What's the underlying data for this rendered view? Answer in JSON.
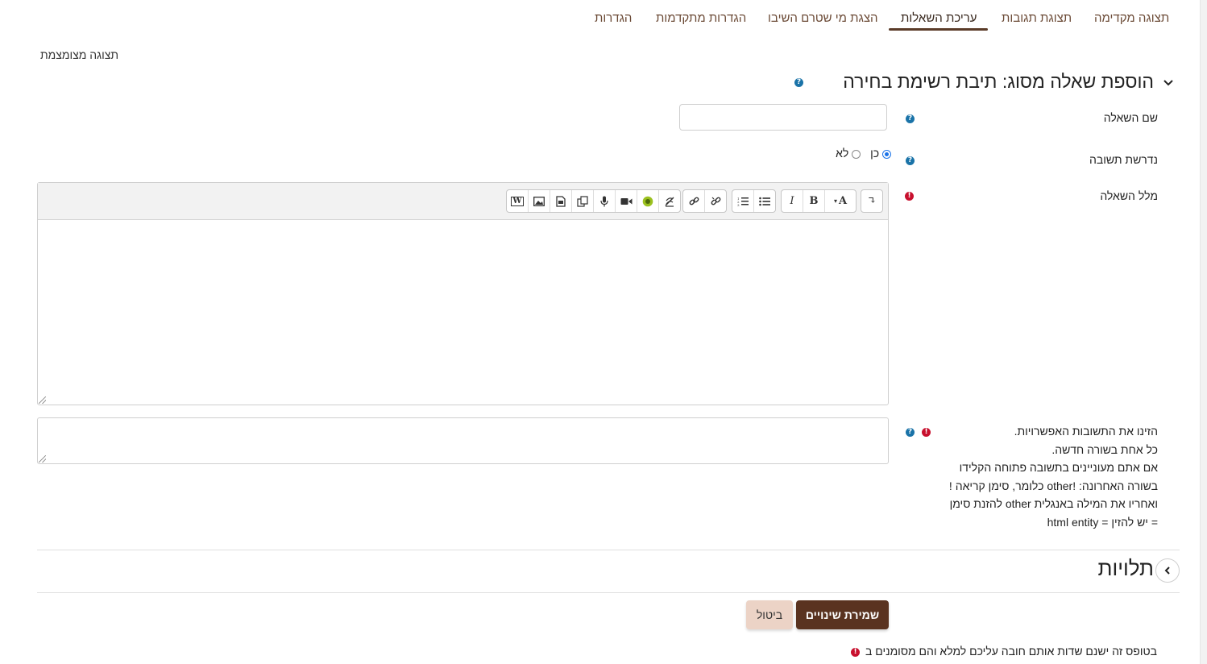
{
  "tabs": [
    {
      "label": "תצוגה מקדימה",
      "active": false
    },
    {
      "label": "תצוגת תגובות",
      "active": false
    },
    {
      "label": "עריכת השאלות",
      "active": true
    },
    {
      "label": "הצגת מי שטרם השיבו",
      "active": false
    },
    {
      "label": "הגדרות מתקדמות",
      "active": false
    },
    {
      "label": "הגדרות",
      "active": false
    }
  ],
  "compact_view_label": "תצוגה מצומצמת",
  "section": {
    "title": "הוספת שאלה מסוג: תיבת רשימת בחירה"
  },
  "form": {
    "question_name_label": "שם השאלה",
    "question_name_value": "",
    "answer_required_label": "נדרשת תשובה",
    "answer_required_options": {
      "yes": "כן",
      "no": "לא"
    },
    "answer_required_selected": "yes",
    "question_text_label": "מלל השאלה",
    "answers_label_lines": [
      "הזינו את התשובות האפשרויות.",
      "כל אחת בשורה חדשה.",
      "אם אתם מעוניינים בתשובה פתוחה הקלידו",
      "בשורה האחרונה: !other כלומר, סימן קריאה !",
      "ואחריו את המילה באנגלית other להזנת סימן",
      "= יש להזין = html entity"
    ]
  },
  "editor_toolbar": {
    "buttons": [
      "undo",
      "font-color",
      "bold",
      "italic",
      "unordered-list",
      "ordered-list",
      "link",
      "unlink",
      "word-paste",
      "image",
      "media",
      "copy",
      "record-audio",
      "record-video",
      "h5p",
      "accessibility"
    ],
    "labels": {
      "font_color": "A",
      "bold": "B",
      "italic": "I"
    }
  },
  "dependencies": {
    "title": "תלויות"
  },
  "buttons": {
    "save": "שמירת שינויים",
    "cancel": "ביטול"
  },
  "footer_note": "בטופס זה ישנם שדות אותם חובה עליכם למלא והם מסומנים ב",
  "colors": {
    "brand": "#5a3320",
    "cancel_bg": "#ecd3c6",
    "tab_text": "#6b4a36",
    "help": "#1a73a8",
    "required": "#c8102e",
    "radio": "#1a73e8"
  }
}
